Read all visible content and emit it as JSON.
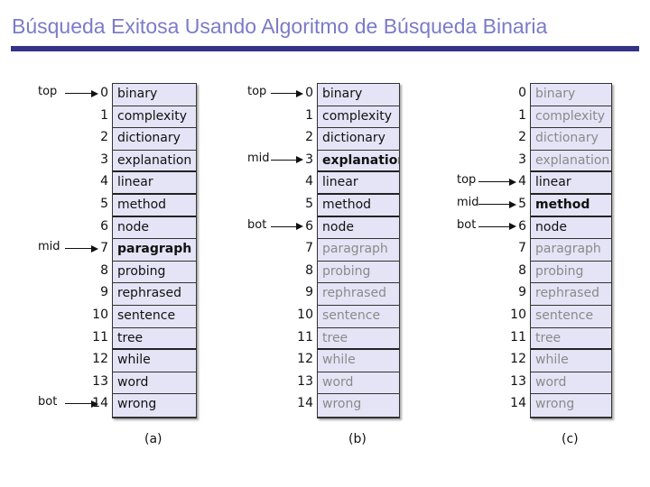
{
  "title": "Búsqueda Exitosa Usando Algoritmo de Búsqueda Binaria",
  "colors": {
    "title": "#7b7bc8",
    "rule": "#333388",
    "cell_bg": "#e4e4f6",
    "active_text": "#111111",
    "inactive_text": "#8a8a8a"
  },
  "words": [
    "binary",
    "complexity",
    "dictionary",
    "explanation",
    "linear",
    "method",
    "node",
    "paragraph",
    "probing",
    "rephrased",
    "sentence",
    "tree",
    "while",
    "word",
    "wrong"
  ],
  "panels": [
    {
      "caption": "(a)",
      "pointers": [
        {
          "label": "top",
          "index": 0
        },
        {
          "label": "mid",
          "index": 7
        },
        {
          "label": "bot",
          "index": 14
        }
      ],
      "active_range": [
        0,
        14
      ],
      "bold_index": 7
    },
    {
      "caption": "(b)",
      "pointers": [
        {
          "label": "top",
          "index": 0
        },
        {
          "label": "mid",
          "index": 3
        },
        {
          "label": "bot",
          "index": 6
        }
      ],
      "active_range": [
        0,
        6
      ],
      "bold_index": 3
    },
    {
      "caption": "(c)",
      "pointers": [
        {
          "label": "top",
          "index": 4
        },
        {
          "label": "mid",
          "index": 5
        },
        {
          "label": "bot",
          "index": 6
        }
      ],
      "active_range": [
        4,
        6
      ],
      "bold_index": 5
    }
  ]
}
